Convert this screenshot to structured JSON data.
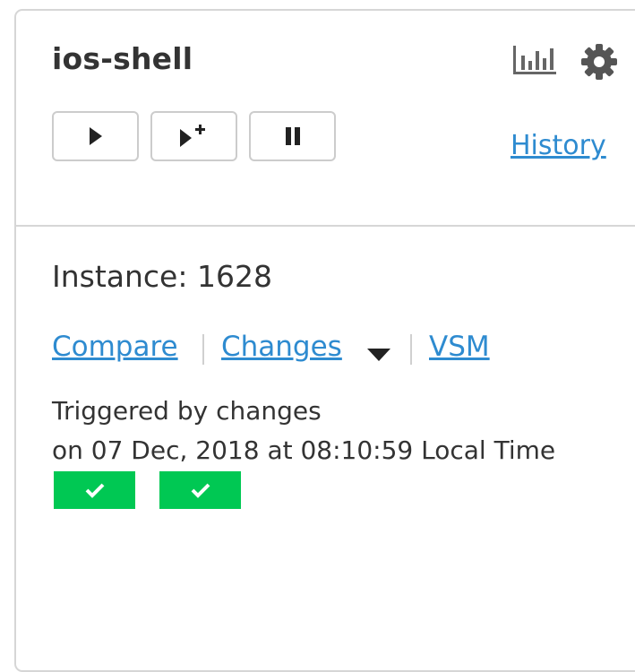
{
  "pipeline": {
    "name": "ios-shell",
    "history_label": "History",
    "icons": {
      "stats": "stats-chart-icon",
      "settings": "gear-icon",
      "trigger": "play-icon",
      "trigger_with_options": "play-plus-icon",
      "pause": "pause-icon",
      "changes_dropdown": "caret-down-icon",
      "stage_passed": "checkmark-icon"
    }
  },
  "instance": {
    "label": "Instance: 1628",
    "links": {
      "compare": "Compare",
      "changes": "Changes",
      "vsm": "VSM"
    },
    "triggered_by": "Triggered by changes",
    "triggered_at": "on 07 Dec, 2018 at 08:10:59 Local Time",
    "stages": [
      {
        "status": "passed"
      },
      {
        "status": "passed"
      }
    ]
  },
  "colors": {
    "link": "#2e8bd0",
    "passed": "#00c853",
    "text": "#333333",
    "icon": "#555555",
    "border": "#d6d6d6"
  }
}
